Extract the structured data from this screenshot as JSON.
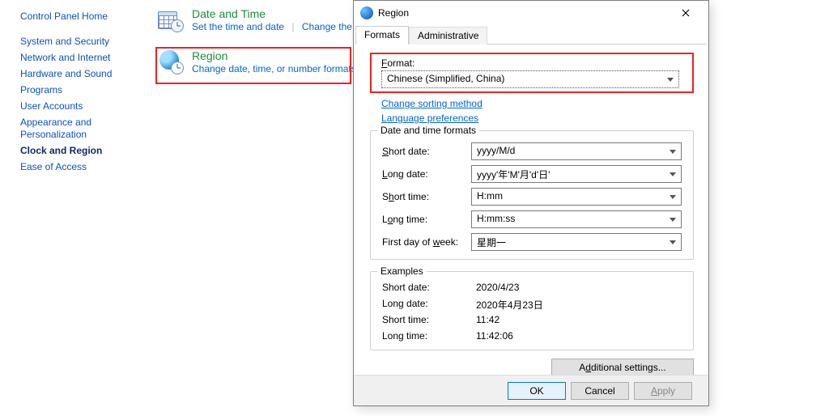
{
  "nav": {
    "home": "Control Panel Home",
    "items": [
      "System and Security",
      "Network and Internet",
      "Hardware and Sound",
      "Programs",
      "User Accounts",
      "Appearance and Personalization",
      "Clock and Region",
      "Ease of Access"
    ],
    "current": "Clock and Region"
  },
  "categories": {
    "datetime": {
      "title": "Date and Time",
      "link1": "Set the time and date",
      "link2_truncated": "Change the tim"
    },
    "region": {
      "title": "Region",
      "link1": "Change date, time, or number formats"
    }
  },
  "dialog": {
    "title": "Region",
    "tabs": {
      "formats": "Formats",
      "admin": "Administrative"
    },
    "format_label": "Format:",
    "format_value": "Chinese (Simplified, China)",
    "link_sort": "Change sorting method",
    "link_lang": "Language preferences",
    "group1_legend": "Date and time formats",
    "rows": {
      "short_date": {
        "label_pre": "S",
        "label_post": "hort date:",
        "value": "yyyy/M/d"
      },
      "long_date": {
        "label_pre": "L",
        "label_post": "ong date:",
        "value": "yyyy'年'M'月'd'日'"
      },
      "short_time": {
        "label_pre": "S",
        "label_post": "hort time:",
        "value": "H:mm"
      },
      "long_time": {
        "label_pre": "L",
        "label_post": "ong time:",
        "value": "H:mm:ss"
      },
      "first_day": {
        "label_pre": "F",
        "label_mid": "irst day of ",
        "label_u2": "w",
        "label_post": "eek:",
        "value": "星期一"
      }
    },
    "group2_legend": "Examples",
    "examples": {
      "short_date": {
        "label": "Short date:",
        "value": "2020/4/23"
      },
      "long_date": {
        "label": "Long date:",
        "value": "2020年4月23日"
      },
      "short_time": {
        "label": "Short time:",
        "value": "11:42"
      },
      "long_time": {
        "label": "Long time:",
        "value": "11:42:06"
      }
    },
    "additional_settings": "Additional settings...",
    "buttons": {
      "ok": "OK",
      "cancel": "Cancel",
      "apply": "Apply"
    }
  }
}
